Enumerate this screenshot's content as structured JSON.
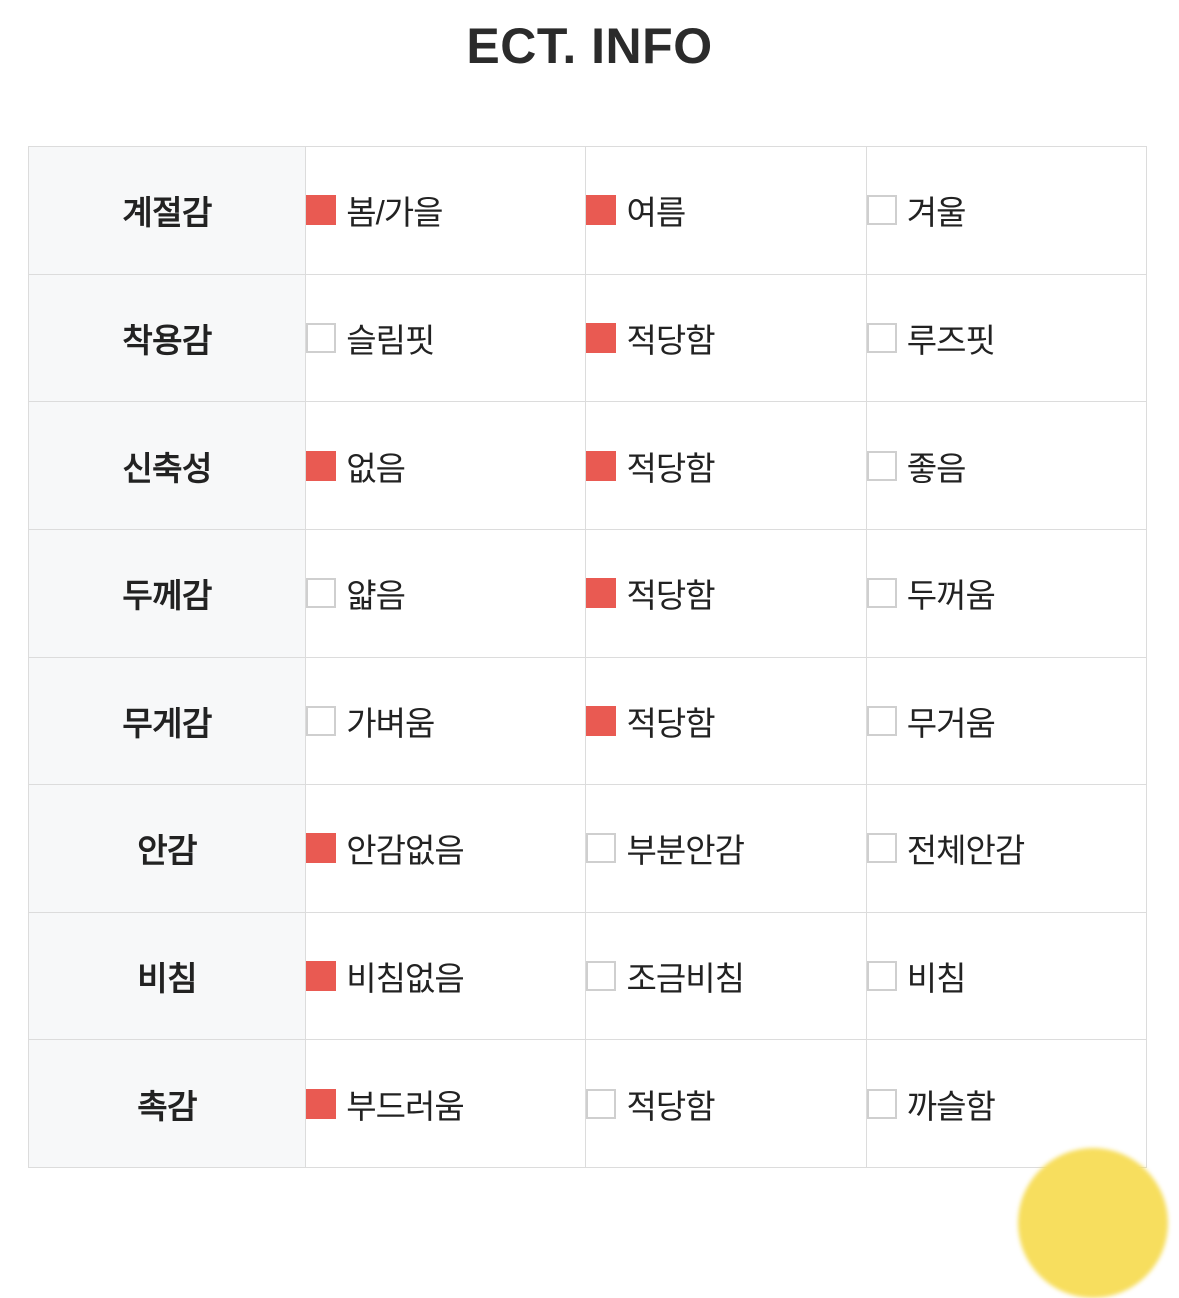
{
  "header": {
    "title": "ECT. INFO"
  },
  "colors": {
    "checked_fill": "#e95a52",
    "unchecked_border": "#cfcfcf",
    "label_bg": "#f7f8f9",
    "table_border": "#dcdcdc",
    "page_bg": "#ffffff",
    "decoration": "#f7de5e"
  },
  "table": {
    "rows": [
      {
        "label": "계절감",
        "options": [
          {
            "text": "봄/가을",
            "checked": true
          },
          {
            "text": "여름",
            "checked": true
          },
          {
            "text": "겨울",
            "checked": false
          }
        ]
      },
      {
        "label": "착용감",
        "options": [
          {
            "text": "슬림핏",
            "checked": false
          },
          {
            "text": "적당함",
            "checked": true
          },
          {
            "text": "루즈핏",
            "checked": false
          }
        ]
      },
      {
        "label": "신축성",
        "options": [
          {
            "text": "없음",
            "checked": true
          },
          {
            "text": "적당함",
            "checked": true
          },
          {
            "text": "좋음",
            "checked": false
          }
        ]
      },
      {
        "label": "두께감",
        "options": [
          {
            "text": "얇음",
            "checked": false
          },
          {
            "text": "적당함",
            "checked": true
          },
          {
            "text": "두꺼움",
            "checked": false
          }
        ]
      },
      {
        "label": "무게감",
        "options": [
          {
            "text": "가벼움",
            "checked": false
          },
          {
            "text": "적당함",
            "checked": true
          },
          {
            "text": "무거움",
            "checked": false
          }
        ]
      },
      {
        "label": "안감",
        "options": [
          {
            "text": "안감없음",
            "checked": true
          },
          {
            "text": "부분안감",
            "checked": false
          },
          {
            "text": "전체안감",
            "checked": false
          }
        ]
      },
      {
        "label": "비침",
        "options": [
          {
            "text": "비침없음",
            "checked": true
          },
          {
            "text": "조금비침",
            "checked": false
          },
          {
            "text": "비침",
            "checked": false
          }
        ]
      },
      {
        "label": "촉감",
        "options": [
          {
            "text": "부드러움",
            "checked": true
          },
          {
            "text": "적당함",
            "checked": false
          },
          {
            "text": "까슬함",
            "checked": false
          }
        ]
      }
    ]
  }
}
